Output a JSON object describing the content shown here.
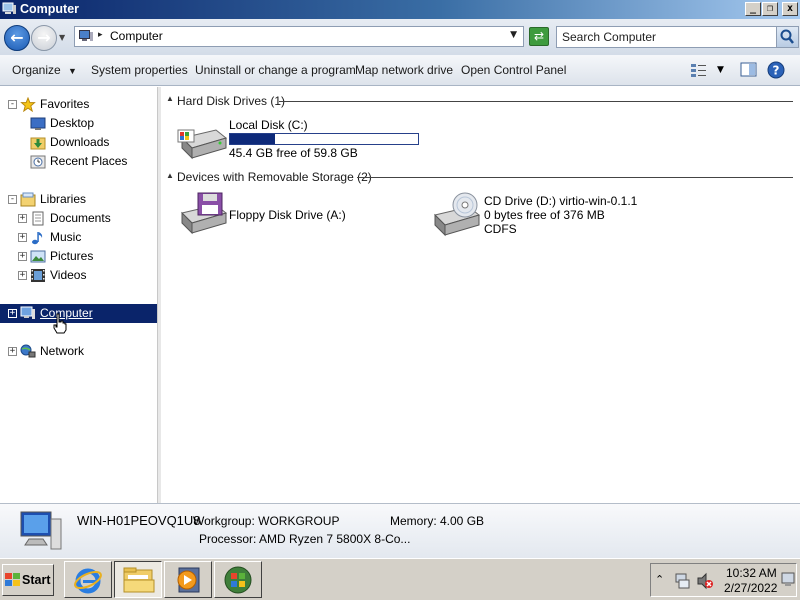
{
  "window": {
    "title": "Computer",
    "caption_buttons": [
      "_",
      "restore",
      "x"
    ]
  },
  "address_bar": {
    "path": "Computer",
    "search_placeholder": "Search Computer"
  },
  "toolbar": {
    "organize": "Organize",
    "system_properties": "System properties",
    "uninstall": "Uninstall or change a program",
    "map_drive": "Map network drive",
    "control_panel": "Open Control Panel"
  },
  "nav": {
    "favorites": "Favorites",
    "desktop": "Desktop",
    "downloads": "Downloads",
    "recent_places": "Recent Places",
    "libraries": "Libraries",
    "documents": "Documents",
    "music": "Music",
    "pictures": "Pictures",
    "videos": "Videos",
    "computer": "Computer",
    "network": "Network"
  },
  "content": {
    "hdd_group": "Hard Disk Drives (1)",
    "removable_group": "Devices with Removable Storage (2)",
    "local_disk": {
      "name": "Local Disk (C:)",
      "free_text": "45.4 GB free of 59.8 GB",
      "used_fraction": 0.241
    },
    "floppy": {
      "name": "Floppy Disk Drive (A:)"
    },
    "cd": {
      "name": "CD Drive (D:) virtio-win-0.1.1",
      "free_text": "0 bytes free of 376 MB",
      "fs": "CDFS"
    }
  },
  "details": {
    "computer_name": "WIN-H01PEOVQ1U8",
    "workgroup": "Workgroup: WORKGROUP",
    "memory": "Memory: 4.00 GB",
    "processor": "Processor: AMD Ryzen 7 5800X 8-Co..."
  },
  "taskbar": {
    "start": "Start",
    "time": "10:32 AM",
    "date": "2/27/2022"
  },
  "colors": {
    "selection": "#0a246a",
    "group_header": "#1e3287",
    "disk_bar": "#0e2a7a"
  }
}
